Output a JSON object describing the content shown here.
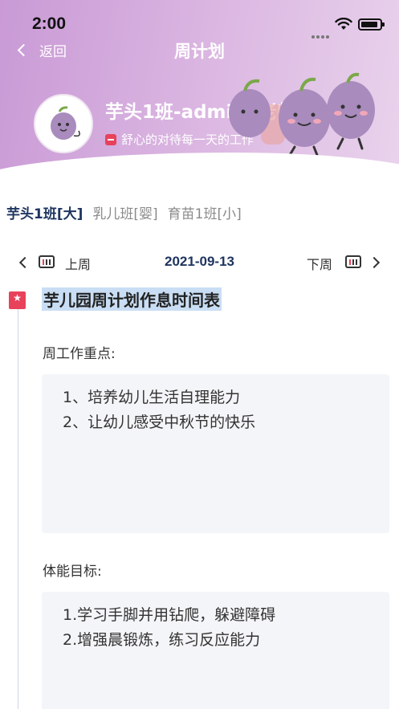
{
  "status_bar": {
    "time": "2:00"
  },
  "nav": {
    "back_label": "返回",
    "title": "周计划"
  },
  "profile": {
    "name": "芋头1班-admin1老师",
    "motto": "舒心的对待每一天的工作"
  },
  "class_tabs": [
    {
      "label": "芋头1班[大]",
      "active": true
    },
    {
      "label": "乳儿班[婴]",
      "active": false
    },
    {
      "label": "育苗1班[小]",
      "active": false
    }
  ],
  "week_nav": {
    "prev_label": "上周",
    "date": "2021-09-13",
    "next_label": "下周"
  },
  "plan": {
    "title": "芋儿园周计划作息时间表",
    "sections": [
      {
        "label": "周工作重点:",
        "lines": [
          "1、培养幼儿生活自理能力",
          "2、让幼儿感受中秋节的快乐"
        ]
      },
      {
        "label": "体能目标:",
        "lines": [
          "1.学习手脚并用钻爬，躲避障碍",
          "2.增强晨锻炼，练习反应能力"
        ]
      }
    ]
  },
  "colors": {
    "accent_dark": "#1f3560",
    "header_purple": "#c99ad6",
    "badge_red": "#e8425b",
    "highlight": "#c9def4"
  },
  "icons": [
    "back-chevron-icon",
    "wifi-icon",
    "battery-icon",
    "prev-week-icon",
    "next-week-icon",
    "bookmark-icon"
  ]
}
